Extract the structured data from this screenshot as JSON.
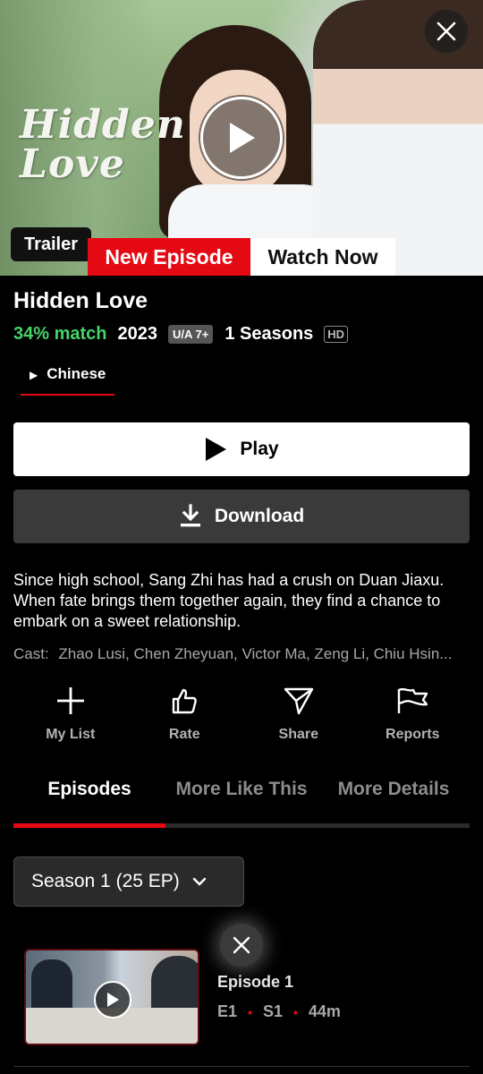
{
  "hero": {
    "logo_text": "Hidden Love",
    "trailer_label": "Trailer",
    "new_episode_label": "New Episode",
    "watch_now_label": "Watch Now"
  },
  "info": {
    "title": "Hidden Love",
    "match": "34% match",
    "year": "2023",
    "rating": "U/A 7+",
    "seasons": "1 Seasons",
    "quality": "HD",
    "language": "Chinese"
  },
  "buttons": {
    "play": "Play",
    "download": "Download"
  },
  "synopsis": "Since high school, Sang Zhi has had a crush on Duan Jiaxu. When fate brings them together again, they find a chance to embark on a sweet relationship.",
  "cast": {
    "label": "Cast:",
    "names": "Zhao Lusi, Chen Zheyuan, Victor Ma, Zeng Li, Chiu Hsin..."
  },
  "actions": [
    {
      "label": "My List",
      "icon": "plus-icon"
    },
    {
      "label": "Rate",
      "icon": "thumbs-up-icon"
    },
    {
      "label": "Share",
      "icon": "send-icon"
    },
    {
      "label": "Reports",
      "icon": "flag-icon"
    }
  ],
  "tabs": [
    {
      "label": "Episodes",
      "active": true
    },
    {
      "label": "More Like This",
      "active": false
    },
    {
      "label": "More Details",
      "active": false
    }
  ],
  "season_select": {
    "value": "Season 1 (25 EP)"
  },
  "episodes": [
    {
      "title": "Episode 1",
      "episode": "E1",
      "season": "S1",
      "duration": "44m"
    }
  ],
  "colors": {
    "accent": "#e50914",
    "match_green": "#46d369",
    "background": "#000000"
  }
}
